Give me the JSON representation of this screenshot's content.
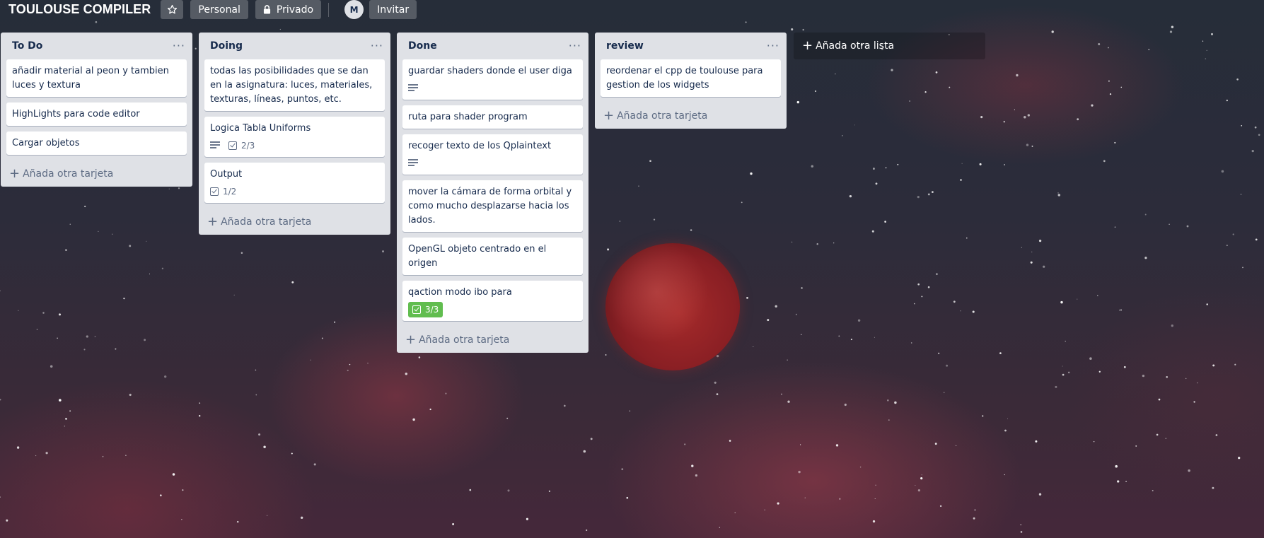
{
  "header": {
    "board_title": "TOULOUSE COMPILER",
    "star_icon": "star-icon",
    "team_label": "Personal",
    "visibility_label": "Privado",
    "avatar_initial": "M",
    "invite_label": "Invitar"
  },
  "lists": [
    {
      "title": "To Do",
      "menu": "···",
      "add_card": "Añada otra tarjeta",
      "cards": [
        {
          "title": "añadir material al peon y tambien luces y textura"
        },
        {
          "title": "HighLights para code editor"
        },
        {
          "title": "Cargar objetos"
        }
      ]
    },
    {
      "title": "Doing",
      "menu": "···",
      "add_card": "Añada otra tarjeta",
      "cards": [
        {
          "title": "todas las posibilidades que se dan en la asignatura: luces, materiales, texturas, líneas, puntos, etc."
        },
        {
          "title": "Logica Tabla Uniforms",
          "checklist": "2/3"
        },
        {
          "title": "Output",
          "checklist": "1/2"
        }
      ]
    },
    {
      "title": "Done",
      "menu": "···",
      "add_card": "Añada otra tarjeta",
      "cards": [
        {
          "title": "guardar shaders donde el user diga"
        },
        {
          "title": "ruta para shader program"
        },
        {
          "title": "recoger texto de los Qplaintext"
        },
        {
          "title": "mover la cámara de forma orbital y como mucho desplazarse hacia los lados."
        },
        {
          "title": "OpenGL objeto centrado en el origen"
        },
        {
          "title": "qaction modo ibo para",
          "checklist": "3/3"
        }
      ]
    },
    {
      "title": "review",
      "menu": "···",
      "add_card": "Añada otra tarjeta",
      "cards": [
        {
          "title": "reordenar el cpp de toulouse para gestion de los widgets"
        }
      ]
    }
  ],
  "add_list": "Añada otra lista",
  "colors": {
    "list_bg": "#dfe1e6",
    "checklist_complete": "#61bd4f",
    "text": "#172b4d",
    "muted": "#5e6c84"
  }
}
